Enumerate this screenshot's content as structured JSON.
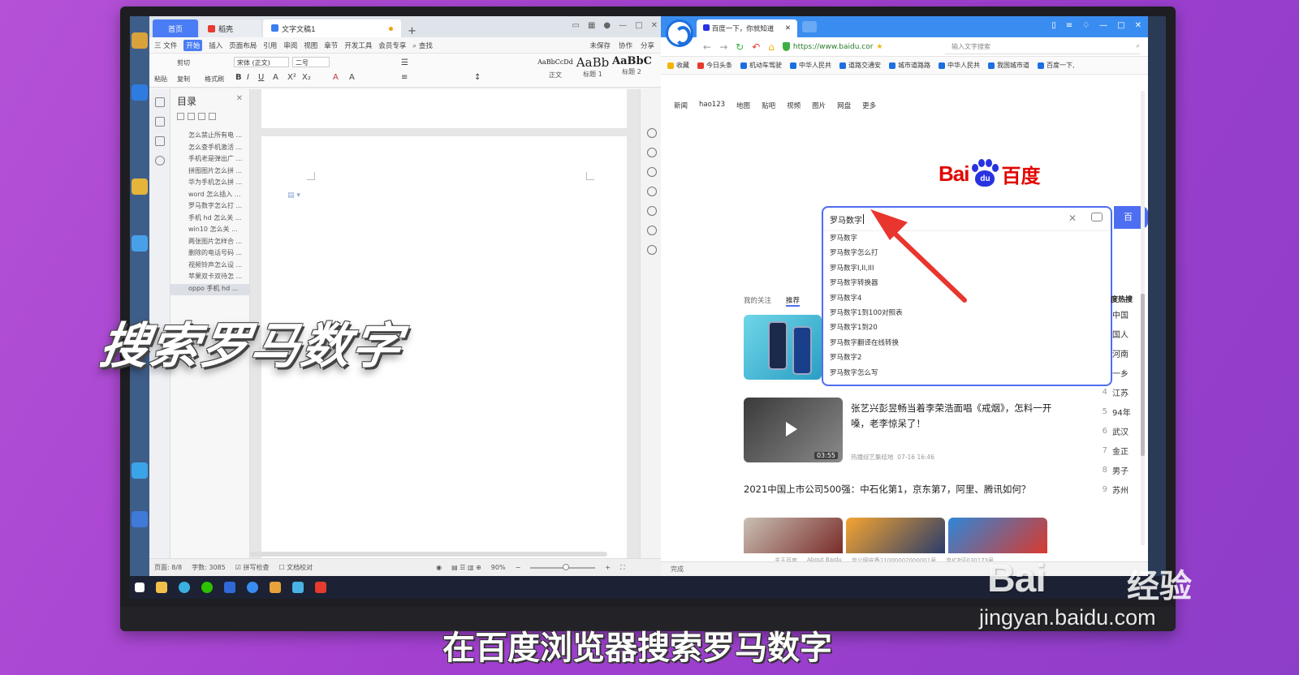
{
  "overlay": {
    "caption": "搜索罗马数字",
    "subtitle": "在百度浏览器搜索罗马数字",
    "watermark_logo": "Bai",
    "watermark_cn": "经验",
    "watermark_url": "jingyan.baidu.com",
    "arrow_color": "#e8352e"
  },
  "wps": {
    "tabs": [
      {
        "label": "首页"
      },
      {
        "label": "稻壳"
      },
      {
        "label": "文字文稿1"
      }
    ],
    "menu": [
      "三 文件",
      "开始",
      "插入",
      "页面布局",
      "引用",
      "审阅",
      "视图",
      "章节",
      "开发工具",
      "会员专享"
    ],
    "menu_search": "查找",
    "menu_right": [
      "未保存",
      "协作",
      "分享"
    ],
    "ribbon": {
      "paste": "粘贴",
      "cut": "剪切",
      "copy": "复制",
      "format_painter": "格式刷",
      "font": "宋体 (正文)",
      "size": "二号",
      "styles": [
        {
          "sample": "AaBbCcDd",
          "label": "正文"
        },
        {
          "sample": "AaBb",
          "label": "标题 1"
        },
        {
          "sample": "AaBbC",
          "label": "标题 2"
        }
      ]
    },
    "toc": {
      "title": "目录",
      "items": [
        "怎么禁止所有电 ...",
        "怎么查手机激活 ...",
        "手机老是弹出广 ...",
        "拼图图片怎么拼 ...",
        "华为手机怎么拼 ...",
        "word 怎么插入 ...",
        "罗马数字怎么打 ...",
        "手机 hd 怎么关 ...",
        "win10 怎么关 ...",
        "两张图片怎样合 ...",
        "删除的电话号码 ...",
        "视频铃声怎么设 ...",
        "苹果双卡双待怎 ...",
        "oppo 手机 hd ..."
      ]
    },
    "status": {
      "page": "页面: 8/8",
      "words": "字数: 3085",
      "spell": "拼写检查",
      "proof": "文档校对",
      "zoom": "90%"
    }
  },
  "browser": {
    "tab_title": "百度一下，你就知道",
    "url": "https://www.baidu.cor",
    "search_placeholder": "输入文字搜索",
    "bookmarks": [
      "收藏",
      "今日头条",
      "机动车驾驶",
      "中华人民共",
      "道路交通安",
      "城市道路路",
      "中华人民共",
      "我国城市道",
      "百度一下,"
    ],
    "baidu_nav": [
      "新闻",
      "hao123",
      "地图",
      "贴吧",
      "视频",
      "图片",
      "网盘",
      "更多"
    ],
    "logo": {
      "latin": "Bai",
      "paw": "du",
      "cn": "百度"
    },
    "search": {
      "query": "罗马数字",
      "button": "百",
      "suggestions": [
        "罗马数字",
        "罗马数字怎么打",
        "罗马数字I,II,III",
        "罗马数字转换器",
        "罗马数字4",
        "罗马数字1到100对照表",
        "罗马数字1到20",
        "罗马数字翻译在线转换",
        "罗马数字2",
        "罗马数字怎么写"
      ]
    },
    "feed_tabs": [
      "我的关注",
      "推荐"
    ],
    "news1_title": "张艺兴彭昱畅当着李荣浩面唱《戒烟》，怎料一开嗓，老李惊呆了！",
    "news1_source": "热播综艺集结地",
    "news1_time": "07-16 16:46",
    "video_duration": "03:55",
    "news2_title": "2021中国上市公司500强：中石化第1，京东第7，阿里、腾讯如何？",
    "hot": {
      "header": "度热搜",
      "rows": [
        {
          "num": "",
          "text": "中国"
        },
        {
          "num": "",
          "text": "国人"
        },
        {
          "num": "",
          "text": "河南"
        },
        {
          "num": "",
          "text": "一乡"
        },
        {
          "num": "4",
          "text": "江苏"
        },
        {
          "num": "5",
          "text": "94年"
        },
        {
          "num": "6",
          "text": "武汉"
        },
        {
          "num": "7",
          "text": "金正"
        },
        {
          "num": "8",
          "text": "男子"
        },
        {
          "num": "9",
          "text": "苏州"
        }
      ]
    },
    "footer": [
      "关于百度",
      "About Baidu",
      "京公网安备11000002000001号",
      "京ICP证030173号"
    ],
    "status": "完成"
  },
  "colors": {
    "wps_blue": "#4a7cf5",
    "sogou_blue": "#3a8df0",
    "baidu_red": "#e10601",
    "baidu_blue": "#2932e1",
    "search_border": "#4e6ef2"
  }
}
